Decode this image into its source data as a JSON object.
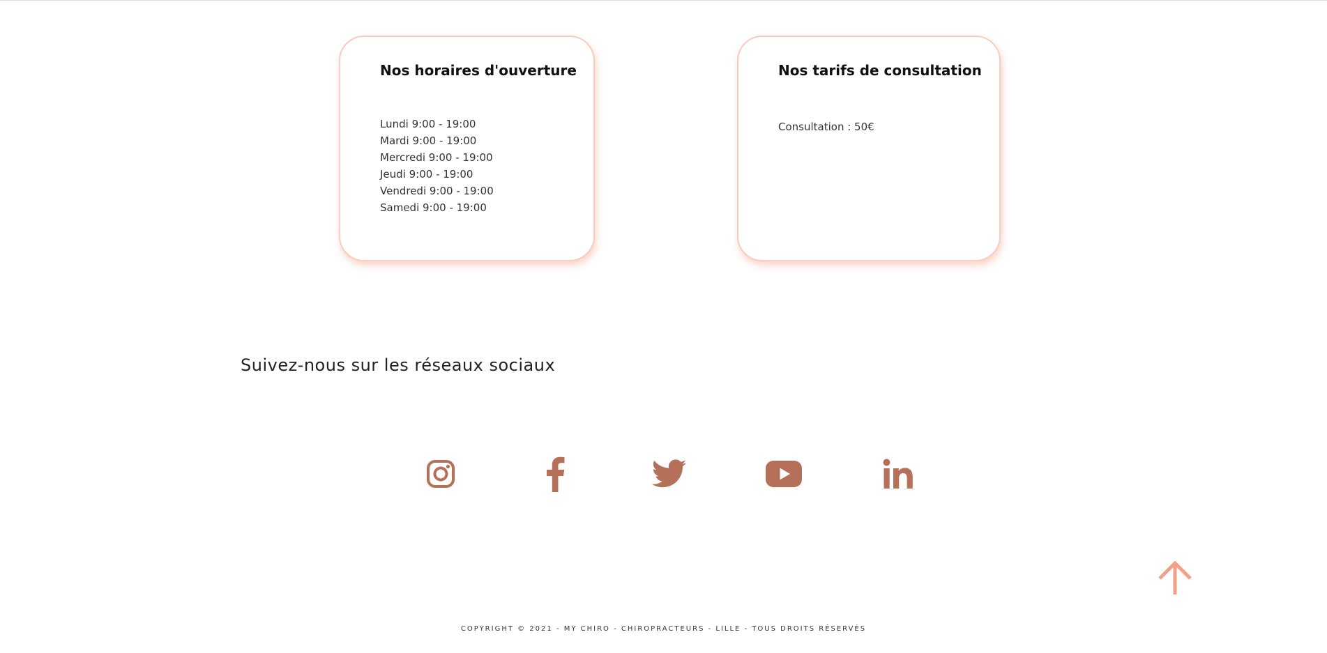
{
  "colors": {
    "accent": "#f2a087",
    "card_border": "#f7cdbf",
    "social_icon": "#b5705a",
    "text": "#222222"
  },
  "hours_card": {
    "title": "Nos horaires d'ouverture",
    "lines": [
      "Lundi 9:00 - 19:00",
      "Mardi 9:00 - 19:00",
      "Mercredi 9:00 - 19:00",
      "Jeudi 9:00 - 19:00",
      "Vendredi 9:00 - 19:00",
      "Samedi 9:00 - 19:00"
    ]
  },
  "rates_card": {
    "title": "Nos tarifs de consultation",
    "lines": [
      "Consultation : 50€"
    ]
  },
  "social": {
    "heading": "Suivez-nous sur les réseaux sociaux",
    "icons": [
      "instagram-icon",
      "facebook-icon",
      "twitter-icon",
      "youtube-icon",
      "linkedin-icon"
    ]
  },
  "back_to_top": {
    "icon": "arrow-up-icon"
  },
  "footer": {
    "copyright": "COPYRIGHT © 2021 - MY CHIRO - CHIROPRACTEURS - LILLE - TOUS DROITS RÉSERVÉS"
  }
}
